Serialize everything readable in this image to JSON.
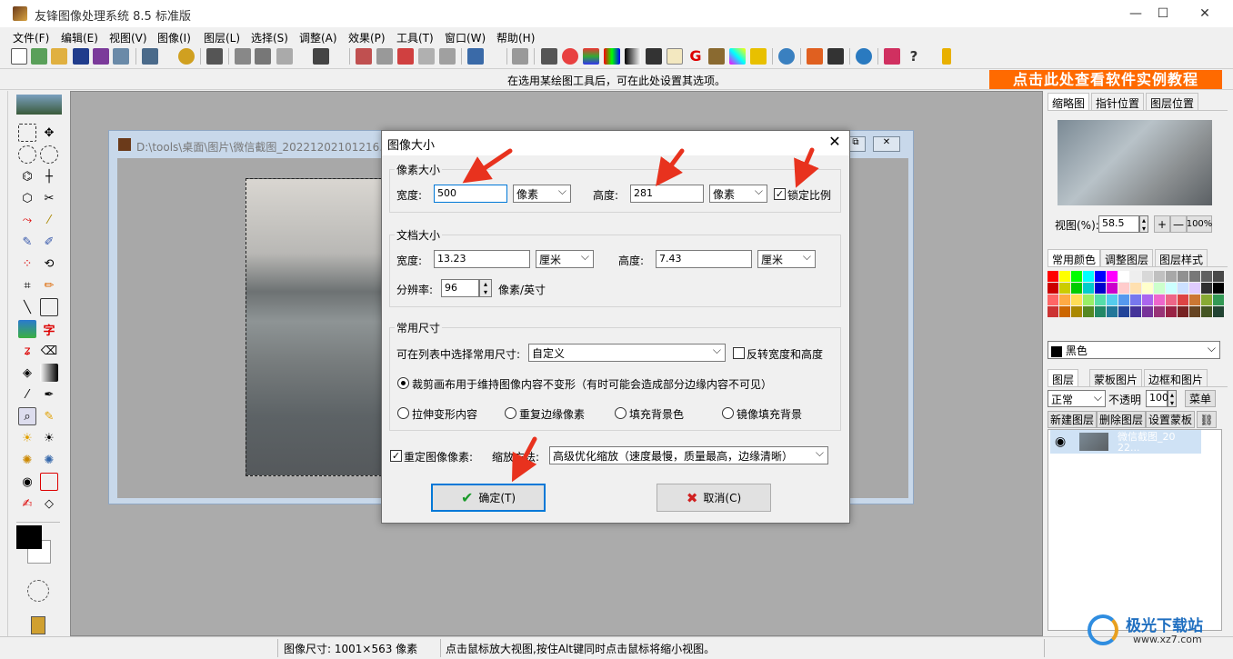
{
  "app": {
    "title": "友锋图像处理系统 8.5 标准版",
    "minimize": "—",
    "maximize": "☐",
    "close": "✕"
  },
  "menu": [
    "文件(F)",
    "编辑(E)",
    "视图(V)",
    "图像(I)",
    "图层(L)",
    "选择(S)",
    "调整(A)",
    "效果(P)",
    "工具(T)",
    "窗口(W)",
    "帮助(H)"
  ],
  "infobar": {
    "hint": "在选用某绘图工具后，可在此处设置其选项。",
    "tutorial": "点击此处查看软件实例教程"
  },
  "image_window": {
    "path": "D:\\tools\\桌面\\图片\\微信截图_20221202101216.p"
  },
  "right_panel": {
    "tabs_top": [
      "缩略图",
      "指针位置",
      "图层位置"
    ],
    "zoom_label": "视图(%):",
    "zoom_value": "58.5",
    "zoom_in": "+",
    "zoom_out": "—",
    "zoom_100": "100%",
    "tabs_mid": [
      "常用颜色",
      "调整图层",
      "图层样式"
    ],
    "color_name": "黑色",
    "tabs_layer": [
      "图层",
      "蒙板图片",
      "边框和图片"
    ],
    "blend_mode": "正常",
    "opacity_label": "不透明",
    "opacity_value": "100",
    "menu_button": "菜单",
    "layer_buttons": [
      "新建图层",
      "删除图层",
      "设置蒙板"
    ],
    "layer_name": "微信截图_2022..."
  },
  "status": {
    "image_size": "图像尺寸: 1001×563 像素",
    "hint": "点击鼠标放大视图,按住Alt键同时点击鼠标将缩小视图。"
  },
  "watermark": {
    "brand": "极光下载站",
    "url": "www.xz7.com"
  },
  "dialog": {
    "title": "图像大小",
    "close": "✕",
    "pixel_group": "像素大小",
    "width_label": "宽度:",
    "width_value": "500",
    "width_unit": "像素",
    "height_label": "高度:",
    "height_value": "281",
    "height_unit": "像素",
    "lock_ratio": "锁定比例",
    "doc_group": "文档大小",
    "doc_width_label": "宽度:",
    "doc_width_value": "13.23",
    "doc_width_unit": "厘米",
    "doc_height_label": "高度:",
    "doc_height_value": "7.43",
    "doc_height_unit": "厘米",
    "resolution_label": "分辨率:",
    "resolution_value": "96",
    "resolution_unit": "像素/英寸",
    "common_group": "常用尺寸",
    "common_label": "可在列表中选择常用尺寸:",
    "common_value": "自定义",
    "reverse_label": "反转宽度和高度",
    "radio_crop": "裁剪画布用于维持图像内容不变形（有时可能会造成部分边缘内容不可见）",
    "radio_stretch": "拉伸变形内容",
    "radio_repeat": "重复边缘像素",
    "radio_fill_bg": "填充背景色",
    "radio_mirror": "镜像填充背景",
    "resample_label": "重定图像像素:",
    "scale_method_label": "缩放方法:",
    "scale_method_value": "高级优化缩放（速度最慢，质量最高，边缘清晰）",
    "ok": "确定(T)",
    "cancel": "取消(C)"
  },
  "colors": {
    "accent": "#0078d7",
    "annotation": "#e8321e",
    "tutorial_bg": "#ff6a00"
  }
}
